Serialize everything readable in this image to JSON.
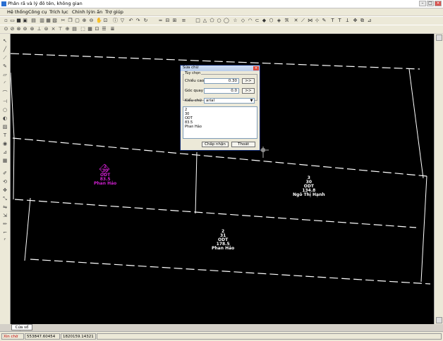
{
  "window": {
    "title": "Phân rã và lý đô tên, không gian"
  },
  "menu": [
    "Hệ thống",
    "Công cụ",
    "Trích lục",
    "Chỉnh lý",
    "In ấn",
    "Trợ giúp"
  ],
  "dialog": {
    "title": "Sửa chữ",
    "group_label": "Tùy chọn",
    "height_label": "Chiều cao",
    "height_value": "0.30",
    "angle_label": "Góc quay",
    "angle_value": "0.0",
    "more_button": ">>",
    "font_label": "Kiểu chữ",
    "font_value": "arial",
    "text_lines": [
      "2",
      "30",
      "ODT",
      "83.5",
      "Phan Hảo"
    ],
    "ok_button": "Chấp nhận",
    "cancel_button": "Thoát"
  },
  "parcels": [
    {
      "lines": [
        "2",
        "30",
        "ODT",
        "83.5",
        "Phan Hảo"
      ],
      "color": "#d020d0"
    },
    {
      "lines": [
        "3",
        "30",
        "ODT",
        "134.8",
        "Ngô Thị Hạnh"
      ],
      "color": "#ffffff"
    },
    {
      "lines": [
        "2",
        "31",
        "ODT",
        "178.5",
        "Phan Hảo"
      ],
      "color": "#ffffff"
    }
  ],
  "command_tab": "Cửa sổ lệnh",
  "status": {
    "mode": "Xin chờ",
    "coord1": "553847.60454",
    "coord2": "1820159.14321"
  },
  "colors": {
    "canvas": "#000000",
    "line": "#ffffff",
    "highlight": "#d020d0",
    "title_active": "#0a246a"
  }
}
